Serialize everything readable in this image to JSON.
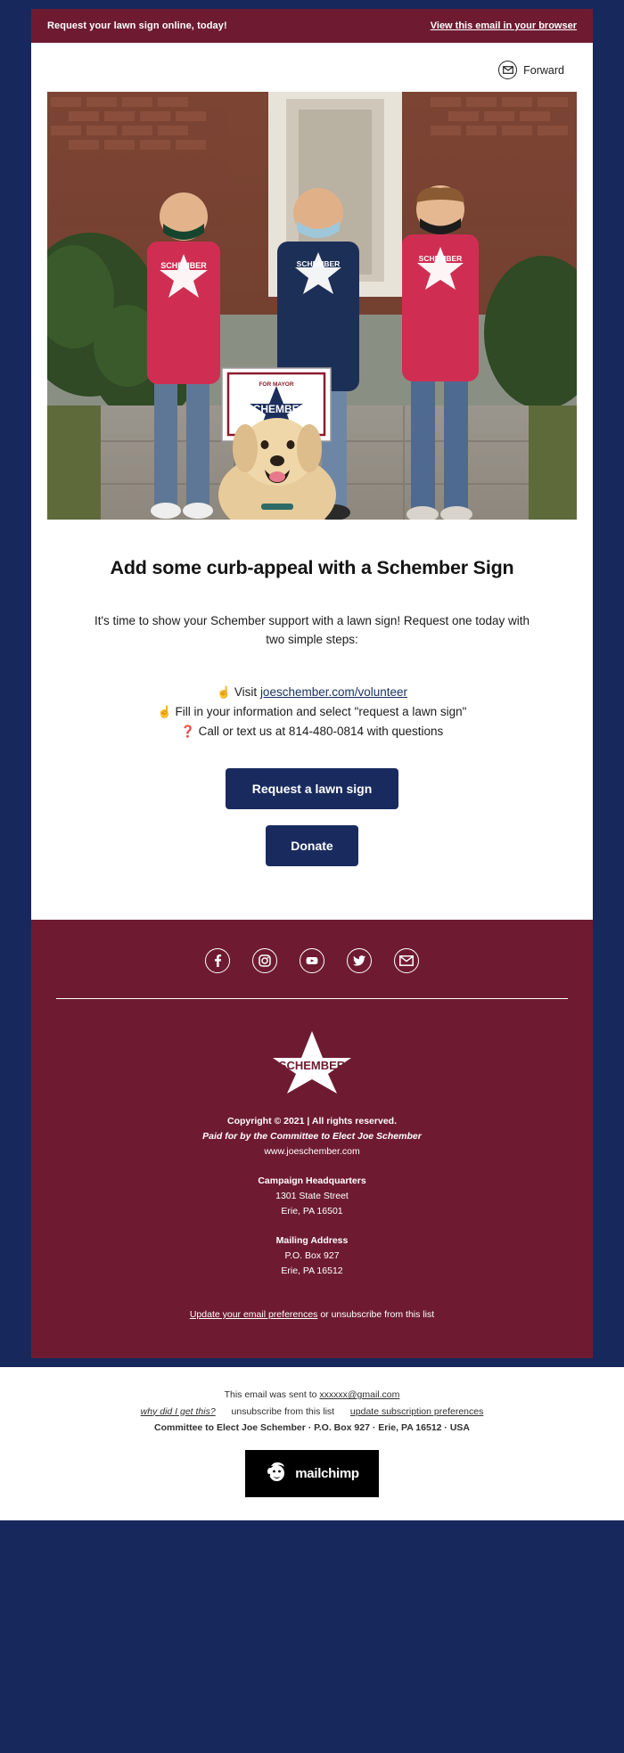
{
  "colors": {
    "page_background": "#16285c",
    "accent_maroon": "#6e1b31",
    "accent_navy": "#192b5e",
    "link_navy": "#17305f",
    "white": "#ffffff"
  },
  "preheader": {
    "text": "Request your lawn sign online, today!",
    "browser_link": "View this email in your browser"
  },
  "forward": {
    "icon": "envelope-circle-icon",
    "label": "Forward"
  },
  "hero": {
    "alt": "Three supporters in Schember t-shirts holding a SCHEMBER FOR MAYOR lawn sign with a golden retriever dog in front",
    "sign_top_text": "FOR MAYOR",
    "sign_text": "SCHEMBER",
    "shirt_text": "SCHEMBER"
  },
  "main": {
    "headline": "Add some curb-appeal with a Schember Sign",
    "intro": "It's time to show your Schember support with a lawn sign! Request one today with two simple steps:",
    "steps": [
      {
        "emoji": "☝️",
        "emoji_name": "pointing-up-hand-icon",
        "prefix": "Visit ",
        "link": "joeschember.com/volunteer",
        "suffix": ""
      },
      {
        "emoji": "☝️",
        "emoji_name": "pointing-up-hand-icon",
        "prefix": "Fill in your information and select \"request a lawn sign\"",
        "link": "",
        "suffix": ""
      },
      {
        "emoji": "❓",
        "emoji_name": "question-mark-icon",
        "prefix": "Call or text us at 814-480-0814 with questions",
        "link": "",
        "suffix": ""
      }
    ],
    "primary_button": "Request a lawn sign",
    "secondary_button": "Donate"
  },
  "footer": {
    "social": [
      {
        "name": "facebook-icon",
        "label": "Facebook"
      },
      {
        "name": "instagram-icon",
        "label": "Instagram"
      },
      {
        "name": "youtube-icon",
        "label": "YouTube"
      },
      {
        "name": "twitter-icon",
        "label": "Twitter"
      },
      {
        "name": "email-icon",
        "label": "Email"
      }
    ],
    "logo_text": "SCHEMBER",
    "copyright": "Copyright © 2021 | All rights reserved.",
    "paid_for": "Paid for by the Committee to Elect Joe Schember",
    "website": "www.joeschember.com",
    "hq_title": "Campaign Headquarters",
    "hq_street": "1301 State Street",
    "hq_city": "Erie, PA 16501",
    "mail_title": "Mailing Address",
    "mail_street": "P.O. Box 927",
    "mail_city": "Erie, PA 16512",
    "prefs_link": "Update your email preferences",
    "prefs_rest": " or unsubscribe from this list"
  },
  "mailchimp_footer": {
    "sent_to_prefix": "This email was sent to ",
    "sent_to_email": "xxxxxx@gmail.com",
    "why_link": "why did I get this?",
    "unsubscribe_link": "unsubscribe from this list",
    "update_link": "update subscription preferences",
    "address": "Committee to Elect Joe Schember · P.O. Box 927 · Erie, PA 16512 · USA",
    "badge_text": "mailchimp",
    "badge_icon": "mailchimp-monkey-icon"
  }
}
